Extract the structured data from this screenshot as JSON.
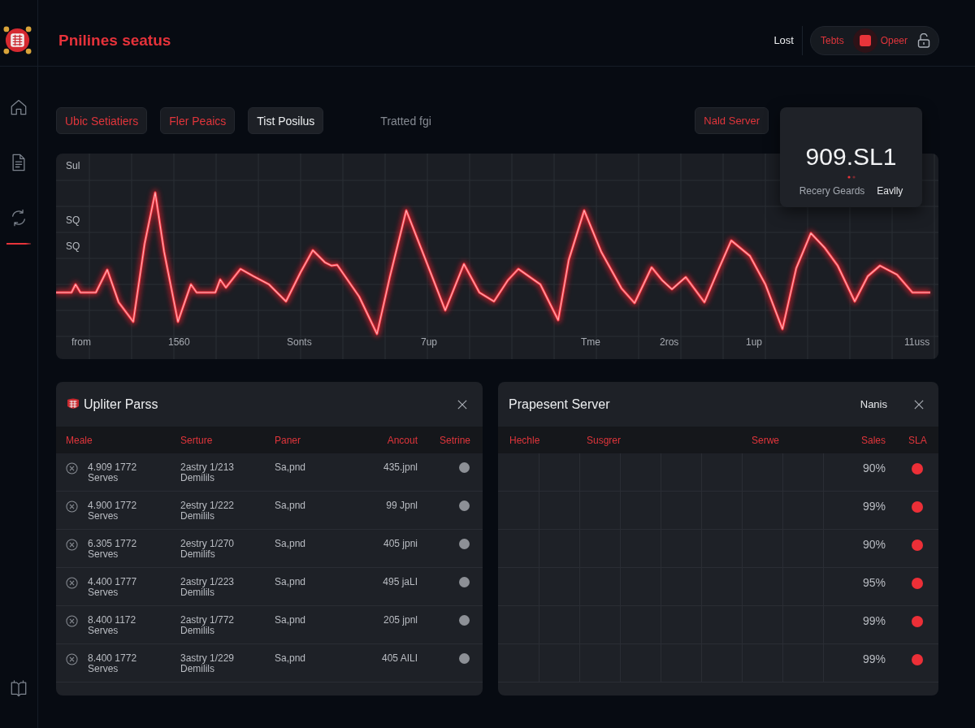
{
  "header": {
    "title": "Pnilines seatus",
    "user_link": "Lost",
    "pill": {
      "left": "Tebts",
      "right": "Opeer"
    }
  },
  "sidebar": {
    "items": [
      {
        "selected": false
      },
      {
        "selected": false
      },
      {
        "selected": true
      }
    ]
  },
  "toolbar": {
    "chips": [
      {
        "label": "Ubic Setiatiers",
        "kind": "accent"
      },
      {
        "label": "Fler Peaics",
        "kind": "accent"
      },
      {
        "label": "Tist Posilus",
        "kind": "neutral"
      }
    ],
    "caption": "Tratted fgi",
    "action": "Nald Server"
  },
  "stat_card": {
    "value": "909.SL1",
    "labels": [
      "Recery Geards",
      "Eavlly"
    ]
  },
  "chart": {
    "y_labels": [
      "Sul",
      "SQ",
      "SQ"
    ],
    "x_labels": [
      "from",
      "1560",
      "Sonts",
      "7up",
      "Tme",
      "2ros",
      "1up",
      "11uss"
    ]
  },
  "left_panel": {
    "title": "Upliter Parss",
    "columns": [
      "Meale",
      "Serture",
      "Paner",
      "Ancout",
      "Setrine"
    ],
    "rows": [
      {
        "meale": "4.909 1772",
        "meale_note": "Serves",
        "serture": "2astry 1/213",
        "serture_note": "Demilils",
        "paner": "Sa,pnd",
        "ancout": "435.jpnl"
      },
      {
        "meale": "4.900 1772",
        "meale_note": "Serves",
        "serture": "2estry 1/222",
        "serture_note": "Demilils",
        "paner": "Sa,pnd",
        "ancout": "99 Jpnl"
      },
      {
        "meale": "6.305 1772",
        "meale_note": "Serves",
        "serture": "2estry 1/270",
        "serture_note": "Demilifs",
        "paner": "Sa,pnd",
        "ancout": "405 jpni"
      },
      {
        "meale": "4.400 1777",
        "meale_note": "Serves",
        "serture": "2astry 1/223",
        "serture_note": "Demilils",
        "paner": "Sa,pnd",
        "ancout": "495 jaLI"
      },
      {
        "meale": "8.400 1172",
        "meale_note": "Serves",
        "serture": "2astry 1/772",
        "serture_note": "Demilils",
        "paner": "Sa,pnd",
        "ancout": "205 jpnl"
      },
      {
        "meale": "8.400 1772",
        "meale_note": "Serves",
        "serture": "3astry 1/229",
        "serture_note": "Demilils",
        "paner": "Sa,pnd",
        "ancout": "405 AILI"
      }
    ]
  },
  "right_panel": {
    "title": "Prapesent Server",
    "filter": "Nanis",
    "columns": [
      "Hechle",
      "Susgrer",
      "Serwe",
      "Sales",
      "SLA"
    ],
    "rows": [
      {
        "sales": "90%"
      },
      {
        "sales": "99%"
      },
      {
        "sales": "90%"
      },
      {
        "sales": "95%"
      },
      {
        "sales": "99%"
      },
      {
        "sales": "99%"
      }
    ]
  }
}
